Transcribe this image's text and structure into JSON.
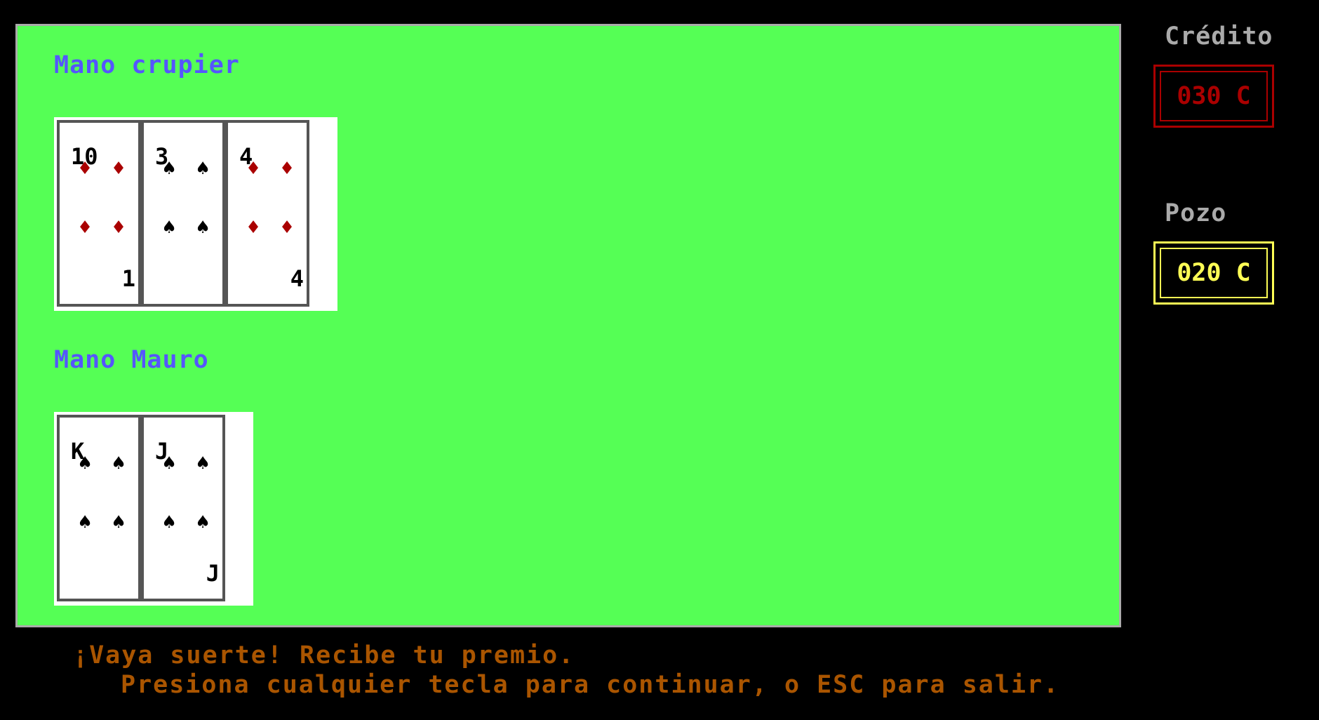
{
  "dealer_hand": {
    "label": "Mano crupier",
    "cards": [
      {
        "rank": "10",
        "corner": "1",
        "suit": "diamond",
        "color": "#aa0000"
      },
      {
        "rank": "3",
        "corner": "",
        "suit": "spade",
        "color": "#000000"
      },
      {
        "rank": "4",
        "corner": "4",
        "suit": "diamond",
        "color": "#aa0000"
      }
    ]
  },
  "player_hand": {
    "label": "Mano Mauro",
    "cards": [
      {
        "rank": "K",
        "corner": "",
        "suit": "spade",
        "color": "#000000"
      },
      {
        "rank": "J",
        "corner": "J",
        "suit": "spade",
        "color": "#000000"
      }
    ]
  },
  "credit": {
    "label": "Crédito",
    "value": "030 C",
    "color": "#aa0000"
  },
  "pot": {
    "label": "Pozo",
    "value": "020 C",
    "color": "#ffff55"
  },
  "message": {
    "line1": "¡Vaya suerte! Recibe tu premio.",
    "line2": "Presiona cualquier tecla para continuar, o ESC para salir."
  },
  "colors": {
    "table": "#55ff55",
    "table_border": "#aaaaaa",
    "hand_label": "#5555ff",
    "message": "#aa5500",
    "background": "#000000"
  }
}
